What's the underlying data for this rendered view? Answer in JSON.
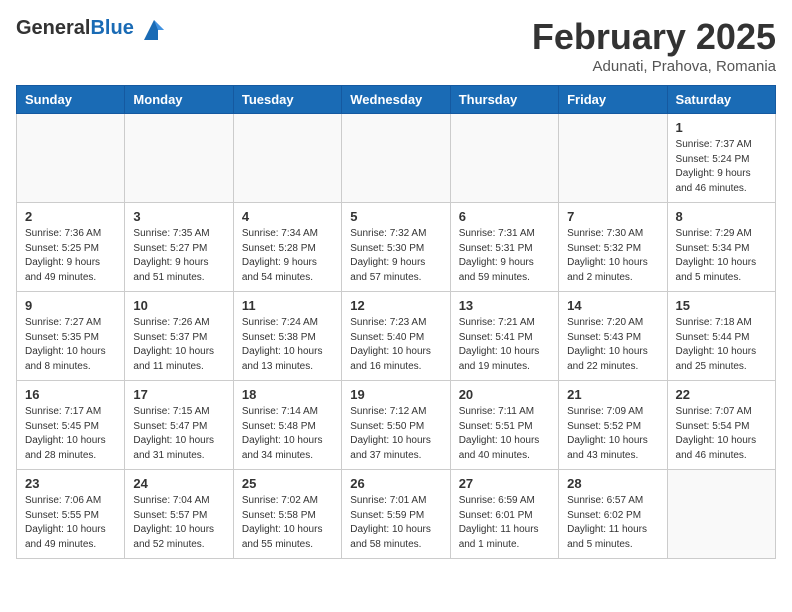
{
  "header": {
    "logo_general": "General",
    "logo_blue": "Blue",
    "month_title": "February 2025",
    "subtitle": "Adunati, Prahova, Romania"
  },
  "weekdays": [
    "Sunday",
    "Monday",
    "Tuesday",
    "Wednesday",
    "Thursday",
    "Friday",
    "Saturday"
  ],
  "weeks": [
    [
      {
        "day": "",
        "info": ""
      },
      {
        "day": "",
        "info": ""
      },
      {
        "day": "",
        "info": ""
      },
      {
        "day": "",
        "info": ""
      },
      {
        "day": "",
        "info": ""
      },
      {
        "day": "",
        "info": ""
      },
      {
        "day": "1",
        "info": "Sunrise: 7:37 AM\nSunset: 5:24 PM\nDaylight: 9 hours and 46 minutes."
      }
    ],
    [
      {
        "day": "2",
        "info": "Sunrise: 7:36 AM\nSunset: 5:25 PM\nDaylight: 9 hours and 49 minutes."
      },
      {
        "day": "3",
        "info": "Sunrise: 7:35 AM\nSunset: 5:27 PM\nDaylight: 9 hours and 51 minutes."
      },
      {
        "day": "4",
        "info": "Sunrise: 7:34 AM\nSunset: 5:28 PM\nDaylight: 9 hours and 54 minutes."
      },
      {
        "day": "5",
        "info": "Sunrise: 7:32 AM\nSunset: 5:30 PM\nDaylight: 9 hours and 57 minutes."
      },
      {
        "day": "6",
        "info": "Sunrise: 7:31 AM\nSunset: 5:31 PM\nDaylight: 9 hours and 59 minutes."
      },
      {
        "day": "7",
        "info": "Sunrise: 7:30 AM\nSunset: 5:32 PM\nDaylight: 10 hours and 2 minutes."
      },
      {
        "day": "8",
        "info": "Sunrise: 7:29 AM\nSunset: 5:34 PM\nDaylight: 10 hours and 5 minutes."
      }
    ],
    [
      {
        "day": "9",
        "info": "Sunrise: 7:27 AM\nSunset: 5:35 PM\nDaylight: 10 hours and 8 minutes."
      },
      {
        "day": "10",
        "info": "Sunrise: 7:26 AM\nSunset: 5:37 PM\nDaylight: 10 hours and 11 minutes."
      },
      {
        "day": "11",
        "info": "Sunrise: 7:24 AM\nSunset: 5:38 PM\nDaylight: 10 hours and 13 minutes."
      },
      {
        "day": "12",
        "info": "Sunrise: 7:23 AM\nSunset: 5:40 PM\nDaylight: 10 hours and 16 minutes."
      },
      {
        "day": "13",
        "info": "Sunrise: 7:21 AM\nSunset: 5:41 PM\nDaylight: 10 hours and 19 minutes."
      },
      {
        "day": "14",
        "info": "Sunrise: 7:20 AM\nSunset: 5:43 PM\nDaylight: 10 hours and 22 minutes."
      },
      {
        "day": "15",
        "info": "Sunrise: 7:18 AM\nSunset: 5:44 PM\nDaylight: 10 hours and 25 minutes."
      }
    ],
    [
      {
        "day": "16",
        "info": "Sunrise: 7:17 AM\nSunset: 5:45 PM\nDaylight: 10 hours and 28 minutes."
      },
      {
        "day": "17",
        "info": "Sunrise: 7:15 AM\nSunset: 5:47 PM\nDaylight: 10 hours and 31 minutes."
      },
      {
        "day": "18",
        "info": "Sunrise: 7:14 AM\nSunset: 5:48 PM\nDaylight: 10 hours and 34 minutes."
      },
      {
        "day": "19",
        "info": "Sunrise: 7:12 AM\nSunset: 5:50 PM\nDaylight: 10 hours and 37 minutes."
      },
      {
        "day": "20",
        "info": "Sunrise: 7:11 AM\nSunset: 5:51 PM\nDaylight: 10 hours and 40 minutes."
      },
      {
        "day": "21",
        "info": "Sunrise: 7:09 AM\nSunset: 5:52 PM\nDaylight: 10 hours and 43 minutes."
      },
      {
        "day": "22",
        "info": "Sunrise: 7:07 AM\nSunset: 5:54 PM\nDaylight: 10 hours and 46 minutes."
      }
    ],
    [
      {
        "day": "23",
        "info": "Sunrise: 7:06 AM\nSunset: 5:55 PM\nDaylight: 10 hours and 49 minutes."
      },
      {
        "day": "24",
        "info": "Sunrise: 7:04 AM\nSunset: 5:57 PM\nDaylight: 10 hours and 52 minutes."
      },
      {
        "day": "25",
        "info": "Sunrise: 7:02 AM\nSunset: 5:58 PM\nDaylight: 10 hours and 55 minutes."
      },
      {
        "day": "26",
        "info": "Sunrise: 7:01 AM\nSunset: 5:59 PM\nDaylight: 10 hours and 58 minutes."
      },
      {
        "day": "27",
        "info": "Sunrise: 6:59 AM\nSunset: 6:01 PM\nDaylight: 11 hours and 1 minute."
      },
      {
        "day": "28",
        "info": "Sunrise: 6:57 AM\nSunset: 6:02 PM\nDaylight: 11 hours and 5 minutes."
      },
      {
        "day": "",
        "info": ""
      }
    ]
  ]
}
